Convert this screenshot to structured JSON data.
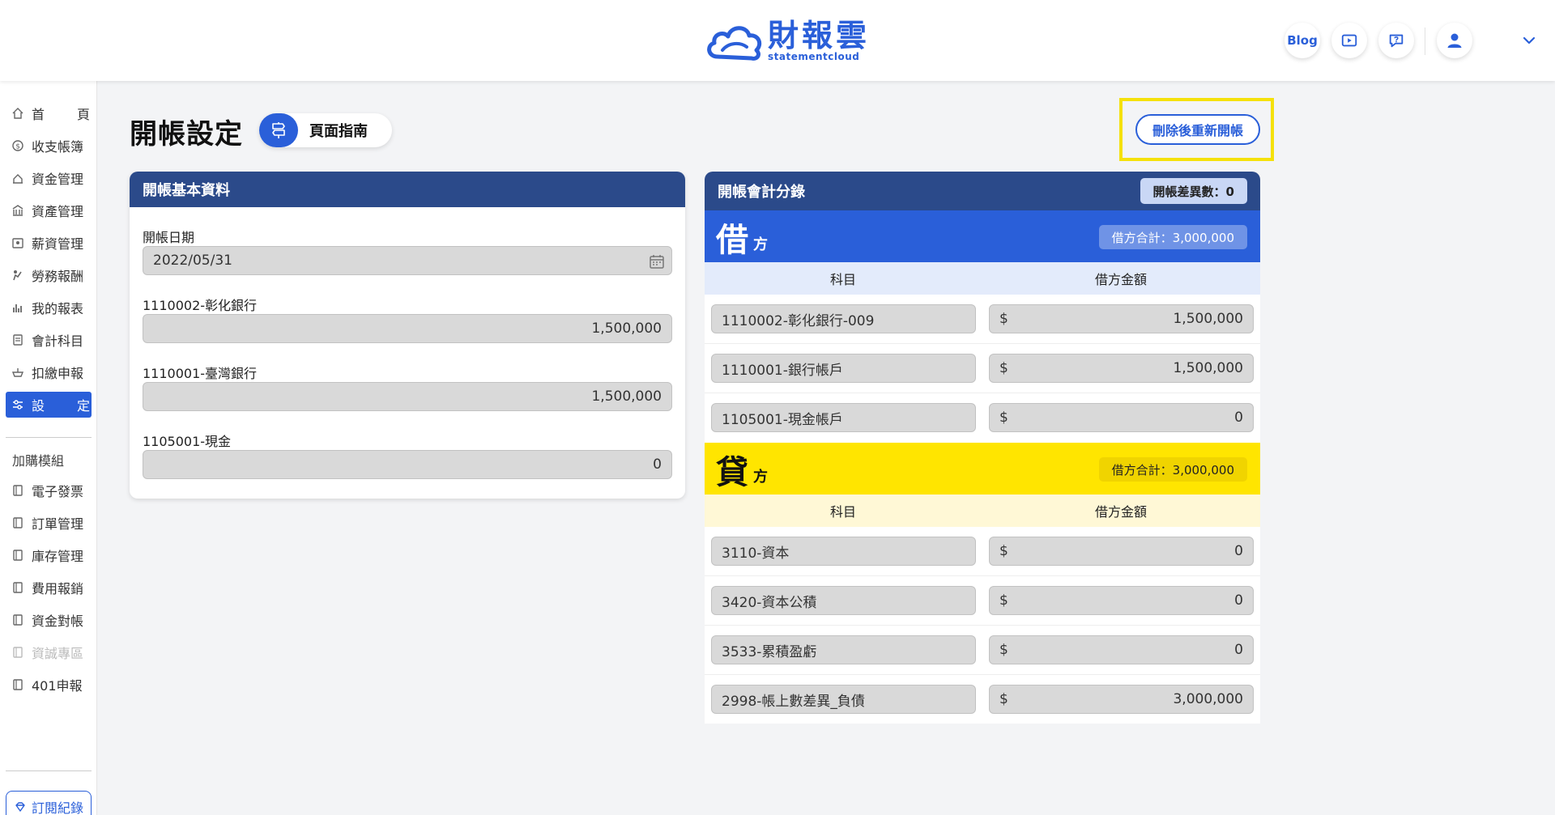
{
  "header": {
    "logo_cn": "財報雲",
    "logo_en": "statementcloud",
    "blog_label": "Blog"
  },
  "sidebar": {
    "items": [
      {
        "label_a": "首",
        "label_b": "頁"
      },
      {
        "label": "收支帳簿"
      },
      {
        "label": "資金管理"
      },
      {
        "label": "資產管理"
      },
      {
        "label": "薪資管理"
      },
      {
        "label": "勞務報酬"
      },
      {
        "label": "我的報表"
      },
      {
        "label": "會計科目"
      },
      {
        "label": "扣繳申報"
      },
      {
        "label_a": "設",
        "label_b": "定"
      }
    ],
    "addon_heading": "加購模組",
    "addons": [
      "電子發票",
      "訂單管理",
      "庫存管理",
      "費用報銷",
      "資金對帳",
      "資誠專區",
      "401申報"
    ],
    "subscription_label": "訂閱紀錄"
  },
  "page": {
    "title": "開帳設定",
    "guide_label": "頁面指南",
    "reset_label": "刪除後重新開帳"
  },
  "basic": {
    "header": "開帳基本資料",
    "date_label": "開帳日期",
    "date_value": "2022/05/31",
    "fields": [
      {
        "label": "1110002-彰化銀行",
        "value": "1,500,000"
      },
      {
        "label": "1110001-臺灣銀行",
        "value": "1,500,000"
      },
      {
        "label": "1105001-現金",
        "value": "0"
      }
    ]
  },
  "entries": {
    "header": "開帳會計分錄",
    "diff_label": "開帳差異數：0",
    "debit": {
      "big": "借",
      "small": "方",
      "total_label": "借方合計：3,000,000",
      "col_account": "科目",
      "col_amount": "借方金額",
      "rows": [
        {
          "account": "1110002-彰化銀行-009",
          "currency": "$",
          "amount": "1,500,000"
        },
        {
          "account": "1110001-銀行帳戶",
          "currency": "$",
          "amount": "1,500,000"
        },
        {
          "account": "1105001-現金帳戶",
          "currency": "$",
          "amount": "0"
        }
      ]
    },
    "credit": {
      "big": "貸",
      "small": "方",
      "total_label": "借方合計：3,000,000",
      "col_account": "科目",
      "col_amount": "借方金額",
      "rows": [
        {
          "account": "3110-資本",
          "currency": "$",
          "amount": "0"
        },
        {
          "account": "3420-資本公積",
          "currency": "$",
          "amount": "0"
        },
        {
          "account": "3533-累積盈虧",
          "currency": "$",
          "amount": "0"
        },
        {
          "account": "2998-帳上數差異_負債",
          "currency": "$",
          "amount": "3,000,000"
        }
      ]
    }
  },
  "colors": {
    "brand_blue": "#2a5fd9",
    "header_navy": "#2b4a8a",
    "credit_yellow": "#ffe500",
    "highlight": "#f5e10a"
  }
}
